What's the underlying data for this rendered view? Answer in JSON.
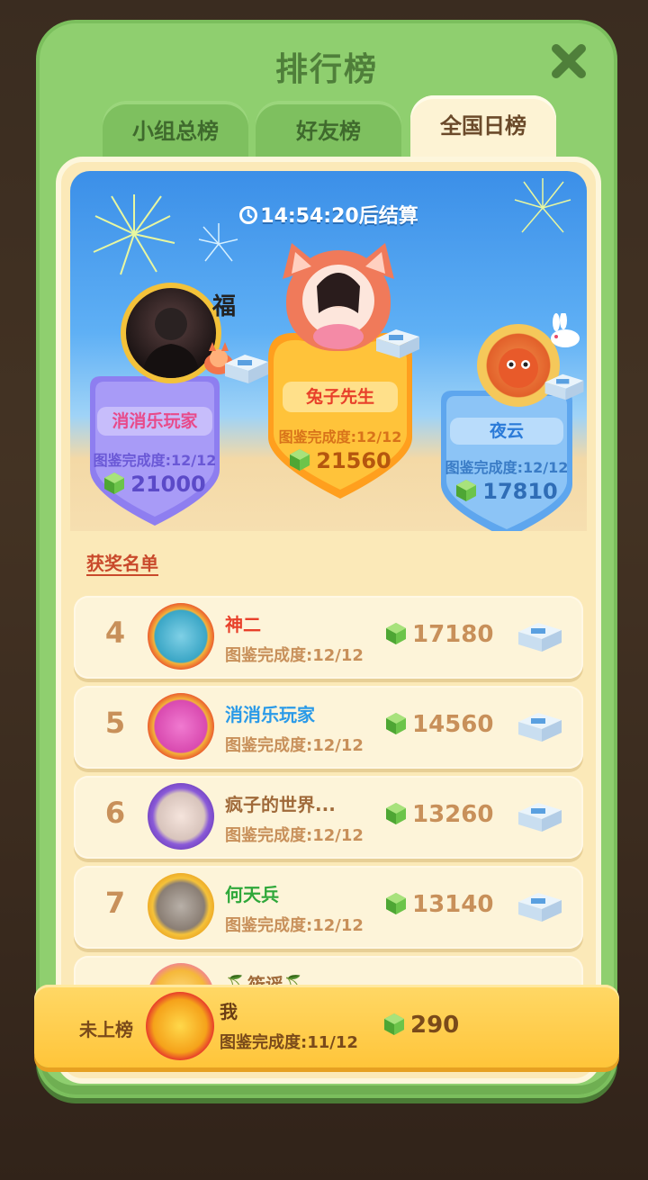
{
  "header": {
    "title": "排行榜"
  },
  "tabs": [
    {
      "label": "小组总榜",
      "active": false
    },
    {
      "label": "好友榜",
      "active": false
    },
    {
      "label": "全国日榜",
      "active": true
    }
  ],
  "timer": {
    "text": "14:54:20后结算"
  },
  "podium": [
    {
      "place": 2,
      "name": "消消乐玩家",
      "progress": "图鉴完成度:12/12",
      "score": "21000",
      "color": "#9b8cf0"
    },
    {
      "place": 1,
      "name": "兔子先生",
      "progress": "图鉴完成度:12/12",
      "score": "21560",
      "color": "#ffb02e"
    },
    {
      "place": 3,
      "name": "夜云",
      "progress": "图鉴完成度:12/12",
      "score": "17810",
      "color": "#6fb2f2"
    }
  ],
  "winners_label": "获奖名单",
  "rows": [
    {
      "rank": "4",
      "name": "神二",
      "progress": "图鉴完成度:12/12",
      "score": "17180",
      "name_color": "#e8402a"
    },
    {
      "rank": "5",
      "name": "消消乐玩家",
      "progress": "图鉴完成度:12/12",
      "score": "14560",
      "name_color": "#2a9ae8"
    },
    {
      "rank": "6",
      "name": "疯子的世界...",
      "progress": "图鉴完成度:12/12",
      "score": "13260",
      "name_color": "#a06a3a"
    },
    {
      "rank": "7",
      "name": "何天兵",
      "progress": "图鉴完成度:12/12",
      "score": "13140",
      "name_color": "#2fa83a"
    },
    {
      "rank": "",
      "name": "🍒筱谣🍒",
      "progress": "",
      "score": "",
      "name_color": "#a06a3a"
    }
  ],
  "my_rank": {
    "label": "未上榜",
    "name": "我",
    "progress": "图鉴完成度:11/12",
    "score": "290"
  },
  "colors": {
    "panel": "#8fcf6f",
    "accent": "#ffc53a",
    "text_brown": "#c8905a"
  }
}
